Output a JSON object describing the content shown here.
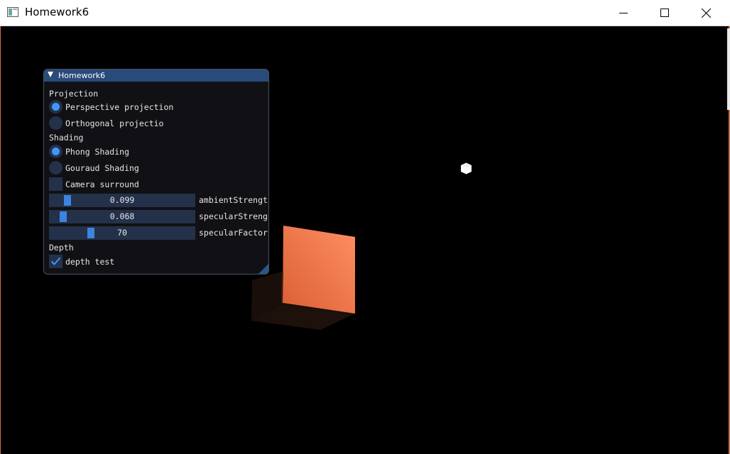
{
  "window": {
    "title": "Homework6",
    "icon": "app-window-icon",
    "controls": {
      "minimize": "minimize-icon",
      "maximize": "maximize-icon",
      "close": "close-icon"
    }
  },
  "panel": {
    "title": "Homework6",
    "sections": {
      "projection": "Projection",
      "shading": "Shading",
      "depth": "Depth"
    },
    "projection_options": [
      {
        "label": "Perspective projection",
        "selected": true
      },
      {
        "label": "Orthogonal projectio",
        "selected": false
      }
    ],
    "shading_options": [
      {
        "label": "Phong Shading",
        "selected": true
      },
      {
        "label": "Gouraud Shading",
        "selected": false
      }
    ],
    "camera_surround": {
      "label": "Camera surround",
      "checked": false
    },
    "sliders": [
      {
        "value": "0.099",
        "label": "ambientStrengt",
        "fraction": 0.099
      },
      {
        "value": "0.068",
        "label": "specularStreng",
        "fraction": 0.068
      },
      {
        "value": "70",
        "label": "specularFactor",
        "fraction": 0.27
      }
    ],
    "depth_test": {
      "label": "depth test",
      "checked": true
    }
  },
  "scene": {
    "background": "#000000",
    "cube_color": "#e66a3f",
    "light_color": "#ffffff"
  },
  "colors": {
    "accent": "#4296fa",
    "frame_bg": "#23314a",
    "title_active": "#294a7a"
  }
}
